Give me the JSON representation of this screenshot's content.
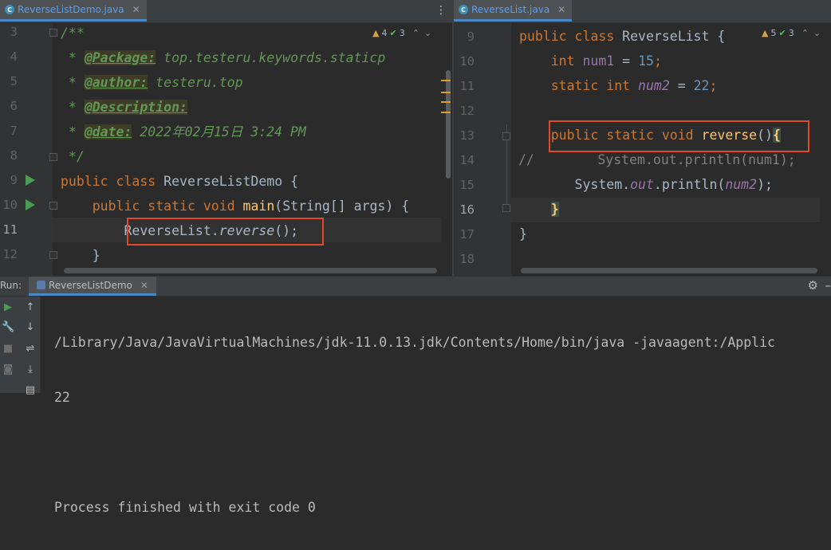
{
  "left_editor": {
    "tab": {
      "label": "ReverseListDemo.java",
      "icon": "java-class-icon"
    },
    "inspection": {
      "warnings": "4",
      "ok": "3"
    },
    "line_numbers": [
      "3",
      "4",
      "5",
      "6",
      "7",
      "8",
      "9",
      "10",
      "11",
      "12"
    ],
    "code": {
      "l3": "/**",
      "l4_prefix": " * ",
      "l4_tag": "@Package:",
      "l4_text": " top.testeru.keywords.staticp",
      "l5_prefix": " * ",
      "l5_tag": "@author:",
      "l5_text": " testeru.top",
      "l6_prefix": " * ",
      "l6_tag": "@Description:",
      "l7_prefix": " * ",
      "l7_tag": "@date:",
      "l7_text": " 2022年02月15日 3:24 PM",
      "l8": " */",
      "l9_kw1": "public",
      "l9_kw2": "class",
      "l9_name": "ReverseListDemo",
      "l9_brace": "{",
      "l10_kw1": "public",
      "l10_kw2": "static",
      "l10_kw3": "void",
      "l10_fn": "main",
      "l10_args": "(String[] args) {",
      "l11_class": "ReverseList.",
      "l11_method": "reverse",
      "l11_end": "();",
      "l12": "}"
    }
  },
  "right_editor": {
    "tab": {
      "label": "ReverseList.java",
      "icon": "java-class-icon"
    },
    "inspection": {
      "warnings": "5",
      "ok": "3"
    },
    "line_numbers": [
      "9",
      "10",
      "11",
      "12",
      "13",
      "14",
      "15",
      "16",
      "17",
      "18"
    ],
    "code": {
      "l9_kw1": "public",
      "l9_kw2": "class",
      "l9_name": "ReverseList",
      "l9_brace": "{",
      "l10_kw": "int",
      "l10_name": "num1",
      "l10_eq": " = ",
      "l10_num": "15",
      "l10_end": ";",
      "l11_kw1": "static",
      "l11_kw2": "int",
      "l11_name": "num2",
      "l11_eq": " = ",
      "l11_num": "22",
      "l11_end": ";",
      "l13_kw1": "public",
      "l13_kw2": "static",
      "l13_kw3": "void",
      "l13_fn": "reverse",
      "l13_paren": "()",
      "l13_brace": "{",
      "l14_comment": "//",
      "l14_code": "System.out.println(num1);",
      "l15_a": "System.",
      "l15_out": "out",
      "l15_b": ".println(",
      "l15_arg": "num2",
      "l15_c": ");",
      "l16_brace": "}",
      "l17_brace": "}"
    }
  },
  "run_panel": {
    "label": "Run:",
    "tab_label": "ReverseListDemo",
    "console_lines": [
      "/Library/Java/JavaVirtualMachines/jdk-11.0.13.jdk/Contents/Home/bin/java -javaagent:/Applic",
      "22",
      "",
      "Process finished with exit code 0"
    ]
  },
  "colors": {
    "accent": "#4a88c7",
    "highlight_box": "#e04a2a",
    "keyword": "#cc7832",
    "method": "#ffc66d",
    "number": "#6897bb",
    "field": "#9876aa",
    "doc_comment": "#629755"
  }
}
